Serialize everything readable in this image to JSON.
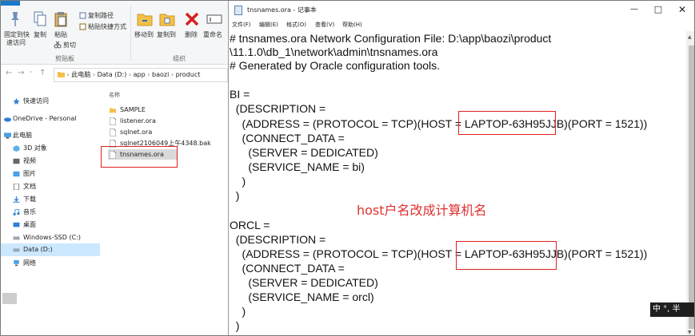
{
  "explorer": {
    "ribbon": {
      "pin_label_1": "固定到快",
      "pin_label_2": "速访问",
      "copy_label": "复制",
      "paste_label": "粘贴",
      "copy_path_label": "复制路径",
      "paste_shortcut_label": "粘贴快捷方式",
      "cut_label": "剪切",
      "move_to_label": "移动到",
      "copy_to_label": "复制到",
      "delete_label": "删除",
      "rename_label": "重命名",
      "clipboard_group": "剪贴板",
      "organize_group": "组织"
    },
    "address": [
      "此电脑",
      "Data (D:)",
      "app",
      "baozi",
      "product"
    ],
    "nav_items": [
      {
        "label": "快速访问",
        "icon": "star-icon"
      },
      {
        "label": "OneDrive - Personal",
        "icon": "cloud-icon"
      },
      {
        "label": "此电脑",
        "icon": "computer-icon"
      },
      {
        "label": "3D 对象",
        "icon": "cube-icon"
      },
      {
        "label": "视频",
        "icon": "video-icon"
      },
      {
        "label": "图片",
        "icon": "picture-icon"
      },
      {
        "label": "文档",
        "icon": "document-icon"
      },
      {
        "label": "下载",
        "icon": "download-icon"
      },
      {
        "label": "音乐",
        "icon": "music-icon"
      },
      {
        "label": "桌面",
        "icon": "desktop-icon"
      },
      {
        "label": "Windows-SSD (C:)",
        "icon": "drive-icon"
      },
      {
        "label": "Data (D:)",
        "icon": "drive-icon"
      },
      {
        "label": "网络",
        "icon": "network-icon"
      }
    ],
    "column_header": "名称",
    "files": [
      {
        "name": "SAMPLE",
        "icon": "folder-icon"
      },
      {
        "name": "listener.ora",
        "icon": "file-icon"
      },
      {
        "name": "sqlnet.ora",
        "icon": "file-icon"
      },
      {
        "name": "sqlnet2106049上午4348.bak",
        "icon": "file-icon"
      },
      {
        "name": "tnsnames.ora",
        "icon": "file-icon"
      }
    ]
  },
  "notepad": {
    "title": "tnsnames.ora - 记事本",
    "menu": [
      "文件(F)",
      "编辑(E)",
      "格式(O)",
      "查看(V)",
      "帮助(H)"
    ],
    "lines": [
      "# tnsnames.ora Network Configuration File: D:\\app\\baozi\\product",
      "\\11.1.0\\db_1\\network\\admin\\tnsnames.ora",
      "# Generated by Oracle configuration tools.",
      "",
      "BI =",
      "  (DESCRIPTION =",
      "    (ADDRESS = (PROTOCOL = TCP)(HOST = LAPTOP-63H95JJB)(PORT = 1521))",
      "    (CONNECT_DATA =",
      "      (SERVER = DEDICATED)",
      "      (SERVICE_NAME = bi)",
      "    )",
      "  )",
      "",
      "ORCL =",
      "  (DESCRIPTION =",
      "    (ADDRESS = (PROTOCOL = TCP)(HOST = LAPTOP-63H95JJB)(PORT = 1521))",
      "    (CONNECT_DATA =",
      "      (SERVER = DEDICATED)",
      "      (SERVICE_NAME = orcl)",
      "    )",
      "  )"
    ],
    "annotation": "host户名改成计算机名",
    "ime": "中 °, 半"
  },
  "colors": {
    "highlight_red": "#e02020",
    "annotation_red": "#e03030",
    "selection_blue": "#cce8ff",
    "file_tab_blue": "#1979ca"
  }
}
